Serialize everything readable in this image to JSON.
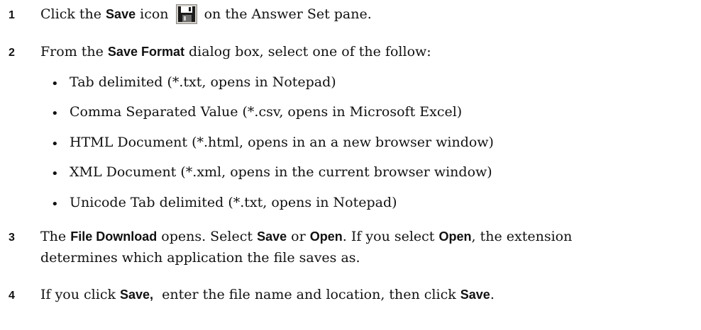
{
  "steps": [
    {
      "number": "1",
      "parts": [
        "Click the ",
        "Save",
        " icon ",
        " on the Answer Set pane."
      ],
      "icon": "floppy-disk-save-icon"
    },
    {
      "number": "2",
      "parts": [
        "From the ",
        "Save Format",
        " dialog box, select one of the follow:"
      ],
      "bullets": [
        "Tab delimited (*.txt, opens in Notepad)",
        "Comma Separated Value (*.csv, opens in Microsoft Excel)",
        "HTML Document (*.html, opens in an a new browser window)",
        "XML Document (*.xml, opens in the current browser window)",
        "Unicode Tab delimited (*.txt, opens in Notepad)"
      ],
      "bullet_symbol": "•"
    },
    {
      "number": "3",
      "parts": [
        "The ",
        "File Download",
        " opens. Select ",
        "Save",
        " or ",
        "Open",
        ". If you select ",
        "Open",
        ", the extension"
      ],
      "line2": "determines which application the file saves as."
    },
    {
      "number": "4",
      "parts": [
        "If you click ",
        "Save,",
        "  enter the file name and location, then click ",
        "Save",
        "."
      ]
    }
  ]
}
